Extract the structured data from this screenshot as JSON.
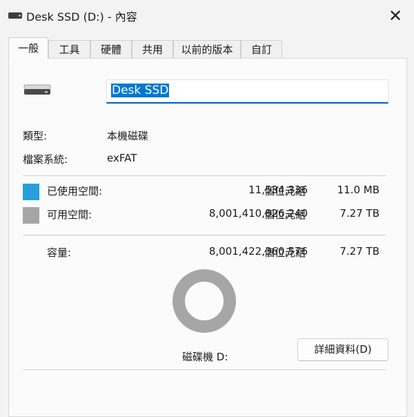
{
  "window": {
    "title": "Desk SSD (D:) - 內容",
    "close_glyph": "✕"
  },
  "tabs": [
    {
      "label": "一般"
    },
    {
      "label": "工具"
    },
    {
      "label": "硬體"
    },
    {
      "label": "共用"
    },
    {
      "label": "以前的版本"
    },
    {
      "label": "自訂"
    }
  ],
  "active_tab": "一般",
  "drive": {
    "name_value": "Desk SSD",
    "type_label": "類型:",
    "type_value": "本機磁碟",
    "fs_label": "檔案系統:",
    "fs_value": "exFAT"
  },
  "usage": {
    "used": {
      "label": "已使用空間:",
      "bytes": "11,534,336",
      "unit": "個位元組",
      "size": "11.0 MB",
      "color": "#26a0da"
    },
    "free": {
      "label": "可用空間:",
      "bytes": "8,001,410,826,240",
      "unit": "個位元組",
      "size": "7.27 TB",
      "color": "#a6a6a6"
    },
    "capacity": {
      "label": "容量:",
      "bytes": "8,001,422,360,576",
      "unit": "個位元組",
      "size": "7.27 TB"
    },
    "used_fraction": 1.4e-06
  },
  "drive_letter_label": "磁碟機 D:",
  "details_button": "詳細資料(D)",
  "icons": {
    "title": "drive-icon",
    "close": "close-icon",
    "drive": "hard-drive-icon"
  }
}
